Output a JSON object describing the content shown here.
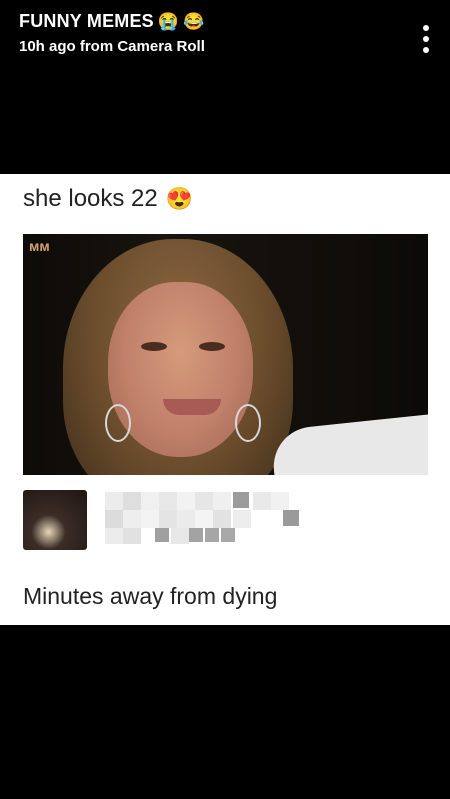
{
  "header": {
    "title": "FUNNY MEMES",
    "emojis": [
      "😭",
      "😂"
    ],
    "subtitle": "10h ago from Camera Roll",
    "more_icon": "more-vertical-icon"
  },
  "meme": {
    "caption_top": "she looks 22",
    "caption_top_emoji": "😍",
    "photo_mark": "ᴍᴍ",
    "caption_bottom": "Minutes away from dying"
  },
  "colors": {
    "background": "#000000",
    "meme_background": "#ffffff",
    "text_dark": "#222222",
    "header_text": "#ffffff"
  }
}
